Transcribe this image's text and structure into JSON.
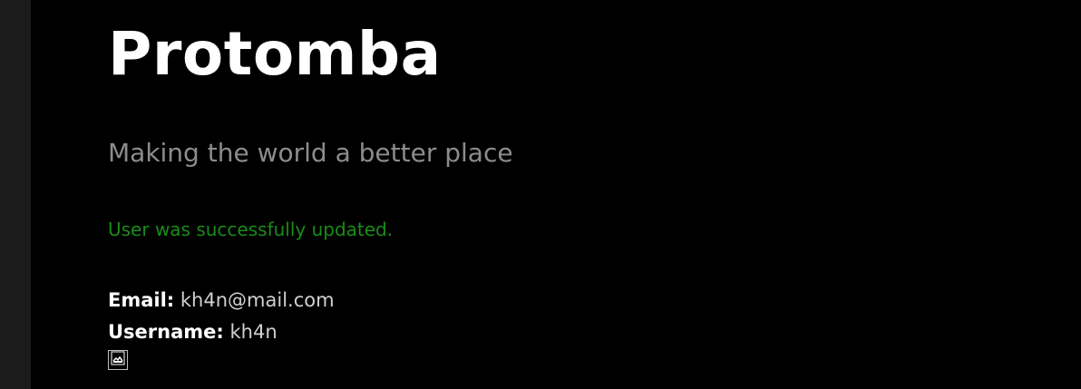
{
  "site": {
    "title": "Protomba",
    "tagline": "Making the world a better place"
  },
  "notice": {
    "text": "User was successfully updated.",
    "color": "#1a8c1a"
  },
  "user": {
    "email_label": "Email:",
    "email_value": "kh4n@mail.com",
    "username_label": "Username:",
    "username_value": "kh4n",
    "avatar_icon": "broken-image-icon"
  },
  "colors": {
    "background": "#000000",
    "sidebar": "#1b1b1b",
    "title": "#ffffff",
    "tagline": "#8c8c8c"
  }
}
